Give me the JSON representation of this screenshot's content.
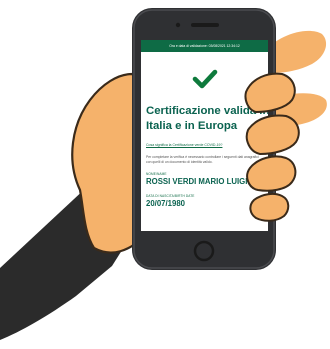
{
  "colors": {
    "header_green": "#0e6b45",
    "title_green": "#0b6350",
    "check_green": "#0e7a3c",
    "hand_orange": "#f5b26b",
    "sleeve": "#2b2b2b",
    "phone_body": "#2f3033"
  },
  "status_bar": {
    "text": "Ora e data di validazione: 03/08/2021 12:34:12"
  },
  "verification": {
    "icon": "check-icon",
    "title_line1": "Certificazione valida in",
    "title_line2": "Italia e in Europa",
    "link_text": "Cosa significa la Certificazione verde COVID-19?",
    "note_text": "Per completare la verifica è necessario controllare i seguenti dati anagrafici con quelli di un documento di identità valido."
  },
  "holder": {
    "name_label": "NOME/NAME",
    "name_value": "ROSSI VERDI MARIO LUIGI",
    "birth_label": "DATA DI NASCITA/BIRTH DATE",
    "birth_value": "20/07/1980"
  }
}
